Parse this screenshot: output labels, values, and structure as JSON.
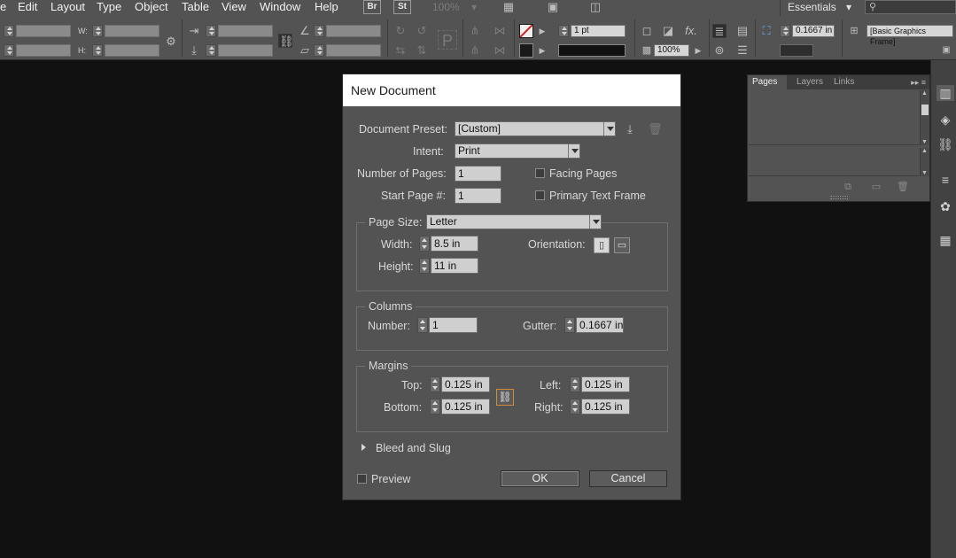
{
  "menubar": {
    "items": [
      "e",
      "Edit",
      "Layout",
      "Type",
      "Object",
      "Table",
      "View",
      "Window",
      "Help"
    ],
    "bridge_label": "Br",
    "stock_label": "St",
    "zoom": "100%",
    "workspace": "Essentials",
    "workspace_arrow": "▾",
    "search_icon": "⚲"
  },
  "controlbar": {
    "w_label": "W:",
    "h_label": "H:",
    "stroke_weight": "1 pt",
    "opacity": "100%",
    "fx_label": "fx.",
    "offset_value": "0.1667 in",
    "object_style": "[Basic Graphics Frame]"
  },
  "pages_panel": {
    "tabs": [
      "Pages",
      "Layers",
      "Links"
    ],
    "menu_glyph": "▸▸ ≡"
  },
  "dialog": {
    "title": "New Document",
    "preset_label": "Document Preset:",
    "preset_value": "[Custom]",
    "intent_label": "Intent:",
    "intent_value": "Print",
    "num_pages_label": "Number of Pages:",
    "num_pages_value": "1",
    "start_page_label": "Start Page #:",
    "start_page_value": "1",
    "facing_pages_label": "Facing Pages",
    "primary_text_frame_label": "Primary Text Frame",
    "page_size_label": "Page Size:",
    "page_size_value": "Letter",
    "width_label": "Width:",
    "width_value": "8.5 in",
    "height_label": "Height:",
    "height_value": "11 in",
    "orientation_label": "Orientation:",
    "columns_legend": "Columns",
    "number_label": "Number:",
    "number_value": "1",
    "gutter_label": "Gutter:",
    "gutter_value": "0.1667 in",
    "margins_legend": "Margins",
    "top_label": "Top:",
    "top_value": "0.125 in",
    "bottom_label": "Bottom:",
    "bottom_value": "0.125 in",
    "left_label": "Left:",
    "left_value": "0.125 in",
    "right_label": "Right:",
    "right_value": "0.125 in",
    "bleed_slug_label": "Bleed and Slug",
    "preview_label": "Preview",
    "ok_label": "OK",
    "cancel_label": "Cancel"
  },
  "colors": {
    "ui_bg": "#535353",
    "workspace_bg": "#111111",
    "field_bg": "#cfcfcf",
    "chain_outline": "#d28a3c"
  }
}
